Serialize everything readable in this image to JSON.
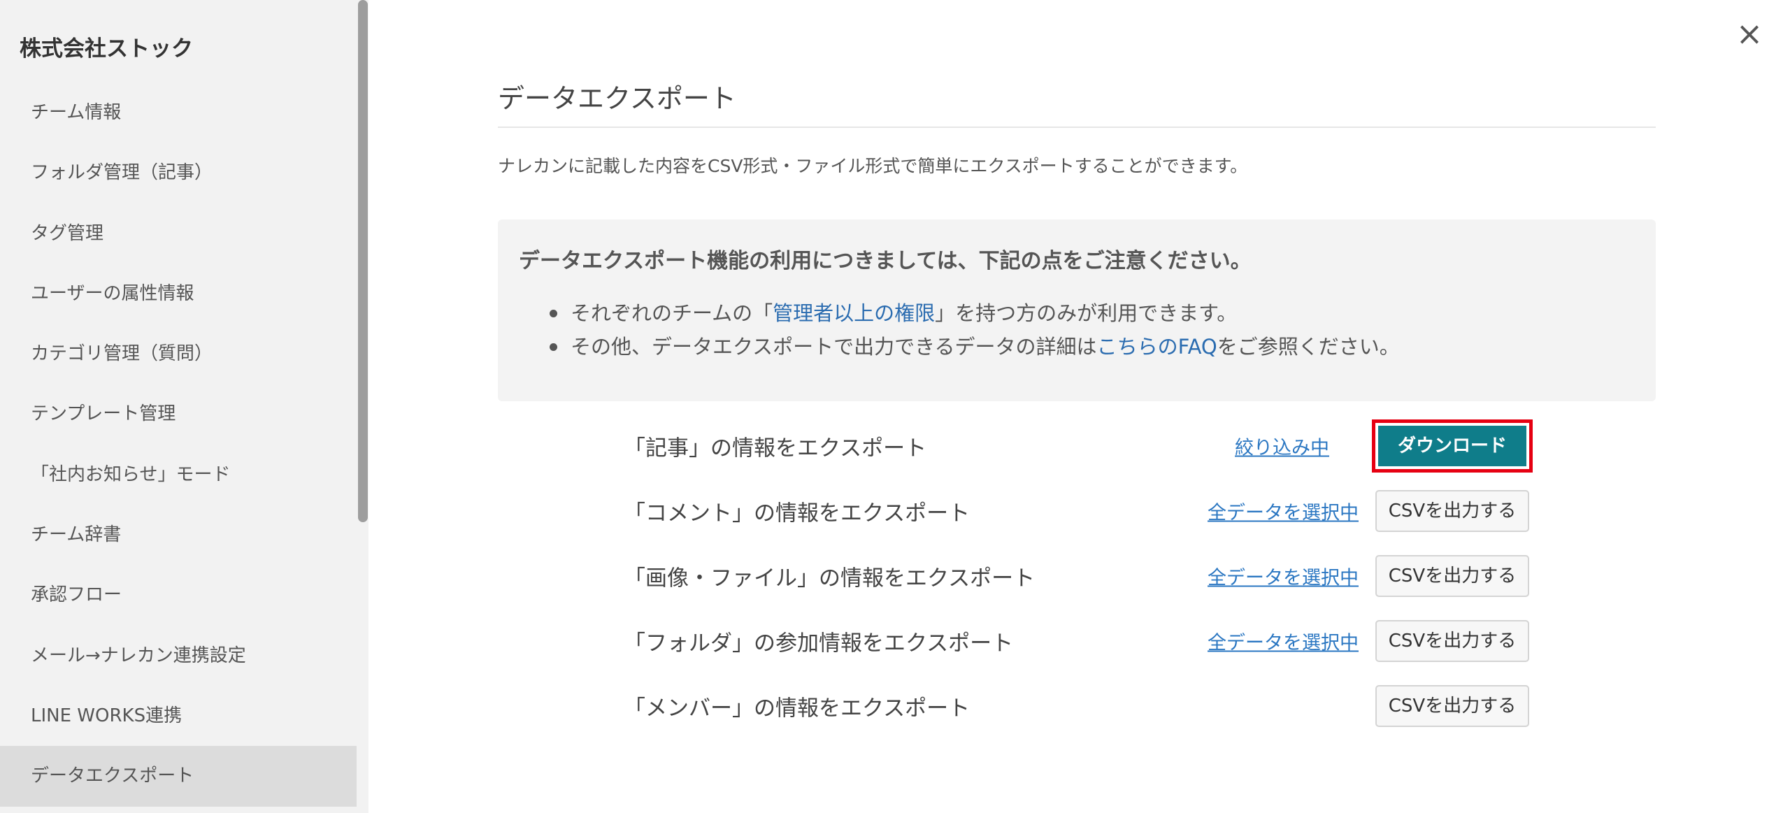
{
  "sidebar": {
    "org_name": "株式会社ストック",
    "items": [
      {
        "label": "チーム情報"
      },
      {
        "label": "フォルダ管理（記事）"
      },
      {
        "label": "タグ管理"
      },
      {
        "label": "ユーザーの属性情報"
      },
      {
        "label": "カテゴリ管理（質問）"
      },
      {
        "label": "テンプレート管理"
      },
      {
        "label": "「社内お知らせ」モード"
      },
      {
        "label": "チーム辞書"
      },
      {
        "label": "承認フロー"
      },
      {
        "label": "メール→ナレカン連携設定"
      },
      {
        "label": "LINE WORKS連携"
      },
      {
        "label": "データエクスポート"
      }
    ],
    "active_index": 11
  },
  "close_icon": "×",
  "main": {
    "title": "データエクスポート",
    "description": "ナレカンに記載した内容をCSV形式・ファイル形式で簡単にエクスポートすることができます。",
    "notice": {
      "heading": "データエクスポート機能の利用につきましては、下記の点をご注意ください。",
      "line1": {
        "before": "それぞれのチームの「",
        "link": "管理者以上の権限",
        "after": "」を持つ方のみが利用できます。"
      },
      "line2": {
        "before": "その他、データエクスポートで出力できるデータの詳細は",
        "link": "こちらのFAQ",
        "after": "をご参照ください。"
      }
    },
    "exports": [
      {
        "label": "「記事」の情報をエクスポート",
        "filter": "絞り込み中",
        "button": "ダウンロード"
      },
      {
        "label": "「コメント」の情報をエクスポート",
        "filter": "全データを選択中",
        "button": "CSVを出力する"
      },
      {
        "label": "「画像・ファイル」の情報をエクスポート",
        "filter": "全データを選択中",
        "button": "CSVを出力する"
      },
      {
        "label": "「フォルダ」の参加情報をエクスポート",
        "filter": "全データを選択中",
        "button": "CSVを出力する"
      },
      {
        "label": "「メンバー」の情報をエクスポート",
        "filter": "",
        "button": "CSVを出力する"
      }
    ]
  },
  "colors": {
    "accent": "#0f7d8a",
    "highlight_border": "#e60012",
    "link": "#2b77c2",
    "sidebar_bg": "#f2f2f2",
    "sidebar_active": "#dcdcdc"
  }
}
